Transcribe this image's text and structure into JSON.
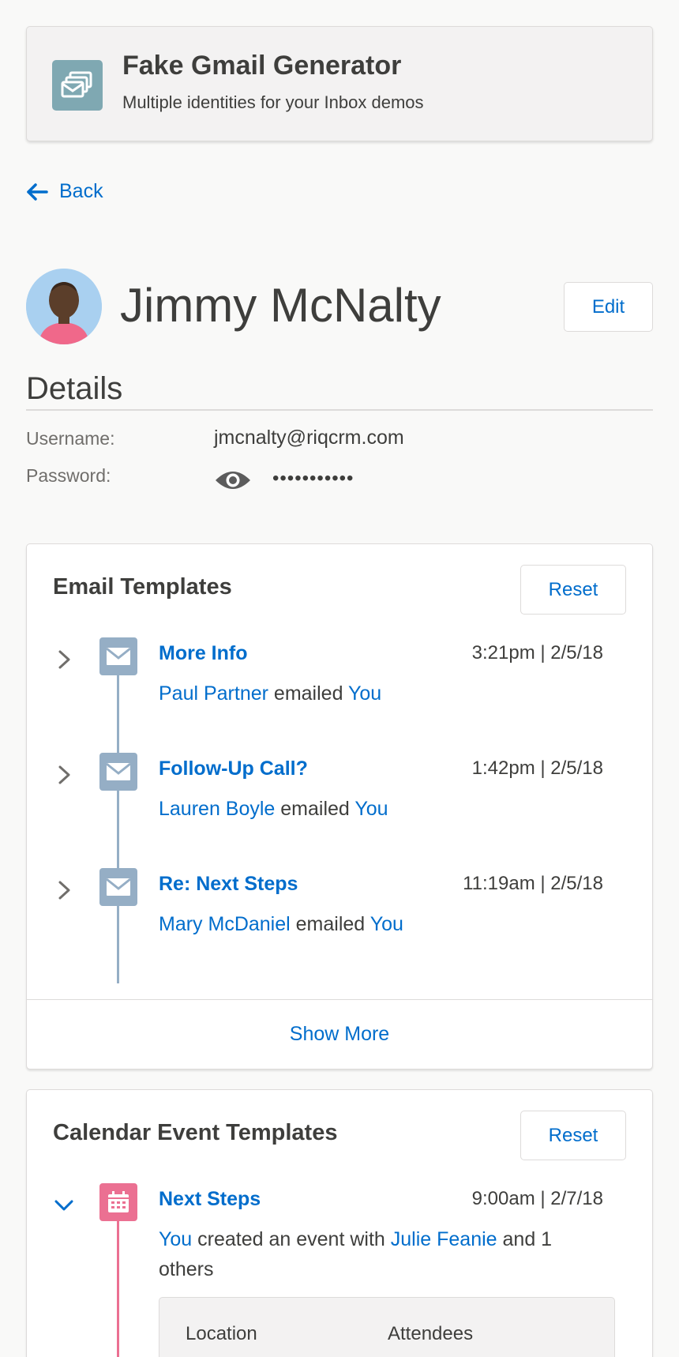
{
  "header": {
    "title": "Fake Gmail Generator",
    "subtitle": "Multiple identities for your Inbox demos",
    "icon": "stacked-mail-icon"
  },
  "nav": {
    "back_label": "Back"
  },
  "profile": {
    "name": "Jimmy McNalty",
    "edit_label": "Edit"
  },
  "details": {
    "heading": "Details",
    "username_label": "Username:",
    "username_value": "jmcnalty@riqcrm.com",
    "password_label": "Password:",
    "password_masked": "•••••••••••"
  },
  "email_templates": {
    "title": "Email Templates",
    "reset_label": "Reset",
    "connector_text": "emailed",
    "items": [
      {
        "subject": "More Info",
        "time": "3:21pm | 2/5/18",
        "sender": "Paul Partner",
        "recipient": "You"
      },
      {
        "subject": "Follow-Up Call?",
        "time": "1:42pm | 2/5/18",
        "sender": "Lauren Boyle",
        "recipient": "You"
      },
      {
        "subject": "Re: Next Steps",
        "time": "11:19am | 2/5/18",
        "sender": "Mary McDaniel",
        "recipient": "You"
      }
    ],
    "show_more_label": "Show More"
  },
  "calendar_templates": {
    "title": "Calendar Event Templates",
    "reset_label": "Reset",
    "items": [
      {
        "subject": "Next Steps",
        "time": "9:00am | 2/7/18",
        "actor": "You",
        "text_mid": "created an event with",
        "invitee": "Julie Feanie",
        "text_end": "and 1 others",
        "location_label": "Location",
        "attendees_label": "Attendees"
      }
    ]
  },
  "colors": {
    "accent": "#006dcc",
    "email_icon": "#95aec5",
    "event_icon": "#eb7092",
    "header_icon": "#7fa8b2"
  }
}
